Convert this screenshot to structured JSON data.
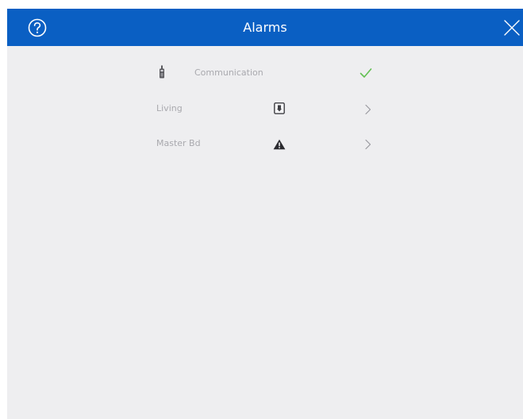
{
  "header": {
    "title": "Alarms",
    "help_icon": "help-circle-icon",
    "close_icon": "close-x-icon",
    "background_color": "#0a5fc3"
  },
  "alarms": [
    {
      "label": "Communication",
      "icon": "communication-device-icon",
      "status_icon": "check-icon",
      "status_color": "#62c052"
    },
    {
      "label": "Living",
      "icon": "door-sensor-icon",
      "status_icon": "chevron-right-icon"
    },
    {
      "label": "Master Bd",
      "icon": "warning-triangle-icon",
      "status_icon": "chevron-right-icon"
    }
  ]
}
